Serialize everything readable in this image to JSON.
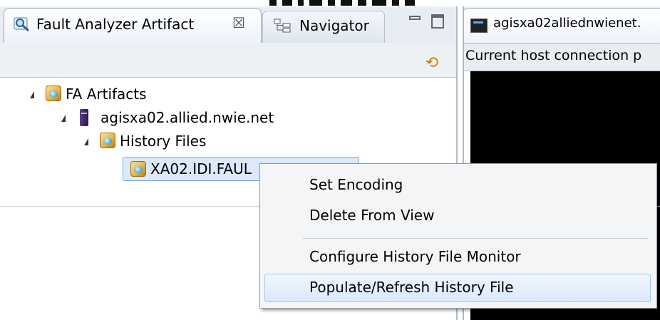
{
  "left_view": {
    "tabs": [
      {
        "label": "Fault Analyzer Artifact",
        "close_glyph": "☒",
        "icon": "magnifier-icon",
        "active": true
      },
      {
        "label": "Navigator",
        "icon": "navigator-tree-icon",
        "active": false
      }
    ],
    "toolbar": {
      "sync_icon": "sync-arrows-icon",
      "sync_glyph": "⟲"
    },
    "window_controls": [
      "minimize",
      "maximize"
    ],
    "tree": [
      {
        "label": "FA Artifacts",
        "icon": "fa-artifact-icon",
        "expanded": true,
        "depth": 0
      },
      {
        "label": "agisxa02.allied.nwie.net",
        "icon": "server-icon",
        "expanded": true,
        "depth": 1
      },
      {
        "label": "History Files",
        "icon": "fa-artifact-icon",
        "expanded": true,
        "depth": 2
      },
      {
        "label": "XA02.IDI.FAUL",
        "icon": "fa-artifact-icon",
        "selected": true,
        "depth": 3
      }
    ]
  },
  "context_menu": {
    "items": [
      {
        "label": "Set Encoding",
        "highlighted": false
      },
      {
        "label": "Delete From View",
        "highlighted": false
      },
      {
        "label": "Configure History File Monitor",
        "highlighted": false
      },
      {
        "label": "Populate/Refresh History File",
        "highlighted": true
      }
    ]
  },
  "right_view": {
    "tab_label": "agisxa02alliednwienet.",
    "tab_icon": "terminal-icon",
    "status_text": "Current host connection p"
  },
  "colors": {
    "tab_bar_bg": "#e8edf4",
    "selection_bg": "#dce9fb",
    "selection_border": "#7aa6da",
    "terminal_bg": "#000000",
    "menu_bg": "#f4f5f7"
  }
}
